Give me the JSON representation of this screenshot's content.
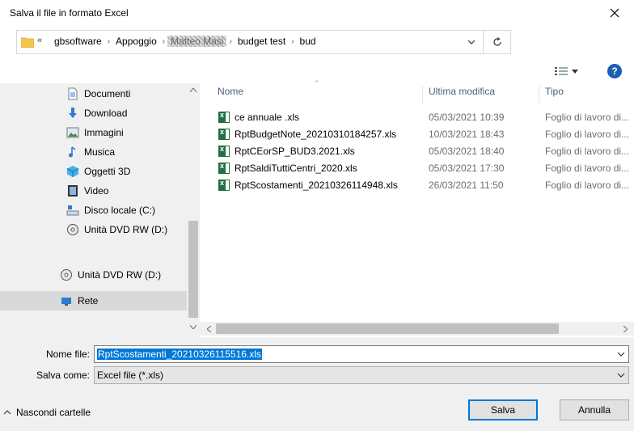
{
  "window": {
    "title": "Salva il file in formato Excel"
  },
  "address": {
    "overflow": "«",
    "crumbs": [
      "gbsoftware",
      "Appoggio",
      "Matteo Masi",
      "budget test",
      "bud"
    ]
  },
  "nav": {
    "items": [
      {
        "label": "Documenti",
        "icon": "document-icon"
      },
      {
        "label": "Download",
        "icon": "download-icon"
      },
      {
        "label": "Immagini",
        "icon": "image-icon"
      },
      {
        "label": "Musica",
        "icon": "music-icon"
      },
      {
        "label": "Oggetti 3D",
        "icon": "cube-icon"
      },
      {
        "label": "Video",
        "icon": "video-icon"
      },
      {
        "label": "Disco locale (C:)",
        "icon": "disk-icon"
      },
      {
        "label": "Unità DVD RW (D:)",
        "icon": "dvd-icon"
      },
      {
        "label": "Unità DVD RW (D:)",
        "icon": "dvd-icon"
      },
      {
        "label": "Rete",
        "icon": "network-icon"
      }
    ]
  },
  "columns": {
    "name": "Nome",
    "modified": "Ultima modifica",
    "type": "Tipo"
  },
  "files": [
    {
      "name": "ce annuale .xls",
      "date": "05/03/2021 10:39",
      "type": "Foglio di lavoro di..."
    },
    {
      "name": "RptBudgetNote_20210310184257.xls",
      "date": "10/03/2021 18:43",
      "type": "Foglio di lavoro di..."
    },
    {
      "name": "RptCEorSP_BUD3.2021.xls",
      "date": "05/03/2021 18:40",
      "type": "Foglio di lavoro di..."
    },
    {
      "name": "RptSaldiTuttiCentri_2020.xls",
      "date": "05/03/2021 17:30",
      "type": "Foglio di lavoro di..."
    },
    {
      "name": "RptScostamenti_20210326114948.xls",
      "date": "26/03/2021 11:50",
      "type": "Foglio di lavoro di..."
    }
  ],
  "form": {
    "filename_label": "Nome file:",
    "filename_value": "RptScostamenti_20210326115516.xls",
    "savetype_label": "Salva come:",
    "savetype_value": "Excel file (*.xls)"
  },
  "footer": {
    "hide_folders": "Nascondi cartelle",
    "save": "Salva",
    "cancel": "Annulla"
  },
  "help": "?",
  "colors": {
    "accent": "#0078d7",
    "selected_nav": "#d9d9d9",
    "excel_green": "#1e7145"
  }
}
